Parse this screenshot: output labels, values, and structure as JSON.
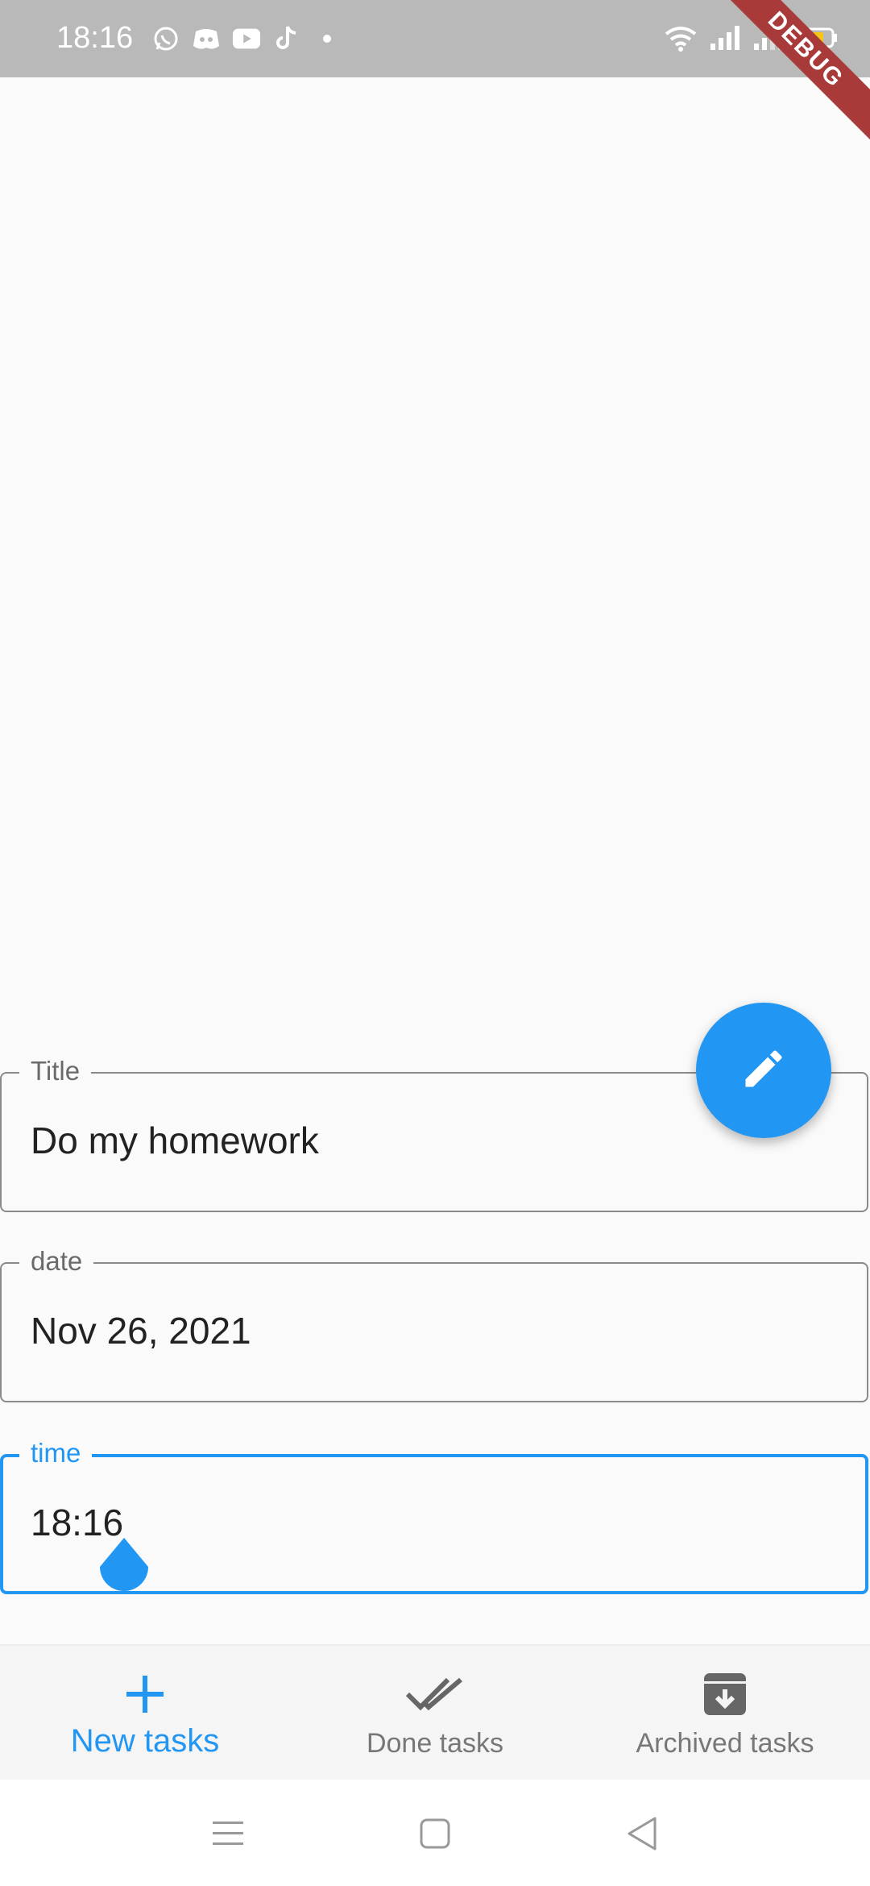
{
  "status_bar": {
    "time": "18:16",
    "left_icons": [
      "whatsapp-icon",
      "discord-icon",
      "youtube-icon",
      "tiktok-icon",
      "dot-icon"
    ],
    "right_icons": [
      "wifi-icon",
      "signal-icon",
      "signal-weak-icon",
      "battery-icon"
    ]
  },
  "debug_banner": "DEBUG",
  "form": {
    "title": {
      "label": "Title",
      "value": "Do my homework"
    },
    "date": {
      "label": "date",
      "value": "Nov 26, 2021"
    },
    "time": {
      "label": "time",
      "value": "18:16"
    }
  },
  "fab": {
    "icon": "edit-icon"
  },
  "bottom_nav": {
    "items": [
      {
        "label": "New tasks",
        "icon": "add-icon",
        "active": true
      },
      {
        "label": "Done tasks",
        "icon": "done-all-icon",
        "active": false
      },
      {
        "label": "Archived tasks",
        "icon": "archive-icon",
        "active": false
      }
    ]
  },
  "colors": {
    "accent": "#2196f3",
    "status_bar": "#b9b9b9",
    "debug_ribbon": "#a83a3a",
    "background": "#fafafa"
  }
}
